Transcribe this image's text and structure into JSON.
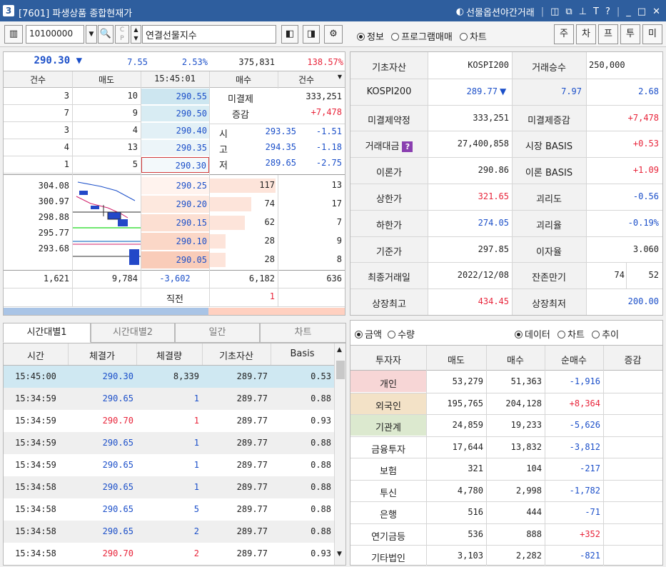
{
  "window": {
    "number": "3",
    "title": "[7601] 파생상품 종합현재가",
    "right_label": "선물옵션야간거래",
    "icons": [
      "restore-icon",
      "popout-icon",
      "pin-icon",
      "font-icon",
      "help-icon",
      "minimize-icon",
      "maximize-icon",
      "close-icon"
    ]
  },
  "toolbar": {
    "code": "10100000",
    "name": "연결선물지수",
    "radios": [
      {
        "label": "정보",
        "on": true
      },
      {
        "label": "프로그램매매",
        "on": false
      },
      {
        "label": "차트",
        "on": false
      }
    ],
    "side_buttons": [
      "주",
      "차",
      "프",
      "투",
      "미"
    ]
  },
  "quote": {
    "price": "290.30",
    "arrow": "▼",
    "change": "7.55",
    "rate": "2.53%",
    "volume": "375,831",
    "vol_ratio": "138.57%"
  },
  "orderbook": {
    "headers": [
      "건수",
      "매도",
      "15:45:01",
      "매수",
      "건수"
    ],
    "asks": [
      {
        "cnt": "3",
        "qty": "10",
        "price": "290.55"
      },
      {
        "cnt": "7",
        "qty": "9",
        "price": "290.50"
      },
      {
        "cnt": "3",
        "qty": "4",
        "price": "290.40"
      },
      {
        "cnt": "4",
        "qty": "13",
        "price": "290.35"
      },
      {
        "cnt": "1",
        "qty": "5",
        "price": "290.30"
      }
    ],
    "info": {
      "oi_label": "미결제",
      "oi_value": "333,251",
      "chg_label": "증감",
      "chg_value": "+7,478",
      "open_label": "시",
      "open_price": "293.35",
      "open_diff": "-1.51",
      "high_label": "고",
      "high_price": "294.35",
      "high_diff": "-1.18",
      "low_label": "저",
      "low_price": "289.65",
      "low_diff": "-2.75"
    },
    "levels": [
      "304.08",
      "300.97",
      "298.88",
      "295.77",
      "293.68"
    ],
    "bids": [
      {
        "price": "290.25",
        "qty": "117",
        "cnt": "13",
        "fill": 1.0
      },
      {
        "price": "290.20",
        "qty": "74",
        "cnt": "17",
        "fill": 0.63
      },
      {
        "price": "290.15",
        "qty": "62",
        "cnt": "7",
        "fill": 0.53
      },
      {
        "price": "290.10",
        "qty": "28",
        "cnt": "9",
        "fill": 0.24
      },
      {
        "price": "290.05",
        "qty": "28",
        "cnt": "8",
        "fill": 0.24
      }
    ],
    "totals": {
      "ask_cnt": "1,621",
      "ask_qty": "9,784",
      "diff": "-3,602",
      "bid_qty": "6,182",
      "bid_cnt": "636"
    },
    "prev_label": "직전",
    "prev_value": "1",
    "bar_ratio": 0.6
  },
  "info": {
    "rows": [
      {
        "l1": "기초자산",
        "v1": "KOSPI200",
        "l2": "거래승수",
        "v2": "250,000"
      },
      {
        "l1": "KOSPI200",
        "v1": "289.77",
        "arrow": "▼",
        "mid": "7.97",
        "v2": "2.68"
      },
      {
        "l1": "미결제약정",
        "v1": "333,251",
        "l2": "미결제증감",
        "v2": "+7,478"
      },
      {
        "l1": "거래대금",
        "v1": "27,400,858",
        "l2": "시장 BASIS",
        "v2": "+0.53"
      },
      {
        "l1": "이론가",
        "v1": "290.86",
        "l2": "이론 BASIS",
        "v2": "+1.09"
      },
      {
        "l1": "상한가",
        "v1": "321.65",
        "l2": "괴리도",
        "v2": "-0.56"
      },
      {
        "l1": "하한가",
        "v1": "274.05",
        "l2": "괴리율",
        "v2": "-0.19%"
      },
      {
        "l1": "기준가",
        "v1": "297.85",
        "l2": "이자율",
        "v2": "3.060"
      },
      {
        "l1": "최종거래일",
        "v1": "2022/12/08",
        "l2": "잔존만기",
        "v2a": "74",
        "v2b": "52"
      },
      {
        "l1": "상장최고",
        "v1": "434.45",
        "l2": "상장최저",
        "v2": "200.00"
      }
    ]
  },
  "trades": {
    "tabs": [
      "시간대별1",
      "시간대별2",
      "일간",
      "차트"
    ],
    "headers": [
      "시간",
      "체결가",
      "체결량",
      "기초자산",
      "Basis"
    ],
    "rows": [
      {
        "time": "15:45:00",
        "price": "290.30",
        "qty": "8,339",
        "base": "289.77",
        "basis": "0.53",
        "color": "blue"
      },
      {
        "time": "15:34:59",
        "price": "290.65",
        "qty": "1",
        "base": "289.77",
        "basis": "0.88",
        "color": "blue"
      },
      {
        "time": "15:34:59",
        "price": "290.70",
        "qty": "1",
        "base": "289.77",
        "basis": "0.93",
        "color": "red"
      },
      {
        "time": "15:34:59",
        "price": "290.65",
        "qty": "1",
        "base": "289.77",
        "basis": "0.88",
        "color": "blue"
      },
      {
        "time": "15:34:59",
        "price": "290.65",
        "qty": "1",
        "base": "289.77",
        "basis": "0.88",
        "color": "blue"
      },
      {
        "time": "15:34:58",
        "price": "290.65",
        "qty": "1",
        "base": "289.77",
        "basis": "0.88",
        "color": "blue"
      },
      {
        "time": "15:34:58",
        "price": "290.65",
        "qty": "5",
        "base": "289.77",
        "basis": "0.88",
        "color": "blue"
      },
      {
        "time": "15:34:58",
        "price": "290.65",
        "qty": "2",
        "base": "289.77",
        "basis": "0.88",
        "color": "blue"
      },
      {
        "time": "15:34:58",
        "price": "290.70",
        "qty": "2",
        "base": "289.77",
        "basis": "0.93",
        "color": "red"
      }
    ]
  },
  "investors": {
    "left_radios": [
      {
        "label": "금액",
        "on": true
      },
      {
        "label": "수량",
        "on": false
      }
    ],
    "right_radios": [
      {
        "label": "데이터",
        "on": true
      },
      {
        "label": "차트",
        "on": false
      },
      {
        "label": "추이",
        "on": false
      }
    ],
    "headers": [
      "투자자",
      "매도",
      "매수",
      "순매수",
      "증감"
    ],
    "rows": [
      {
        "name": "개인",
        "sell": "53,279",
        "buy": "51,363",
        "net": "-1,916",
        "bg": "#f7d6d6"
      },
      {
        "name": "외국인",
        "sell": "195,765",
        "buy": "204,128",
        "net": "+8,364",
        "bg": "#f3e2c7"
      },
      {
        "name": "기관계",
        "sell": "24,859",
        "buy": "19,233",
        "net": "-5,626",
        "bg": "#dce9cf"
      },
      {
        "name": "금융투자",
        "sell": "17,644",
        "buy": "13,832",
        "net": "-3,812",
        "bg": ""
      },
      {
        "name": "보험",
        "sell": "321",
        "buy": "104",
        "net": "-217",
        "bg": ""
      },
      {
        "name": "투신",
        "sell": "4,780",
        "buy": "2,998",
        "net": "-1,782",
        "bg": ""
      },
      {
        "name": "은행",
        "sell": "516",
        "buy": "444",
        "net": "-71",
        "bg": ""
      },
      {
        "name": "연기금등",
        "sell": "536",
        "buy": "888",
        "net": "+352",
        "bg": ""
      },
      {
        "name": "기타법인",
        "sell": "3,103",
        "buy": "2,282",
        "net": "-821",
        "bg": ""
      }
    ]
  }
}
